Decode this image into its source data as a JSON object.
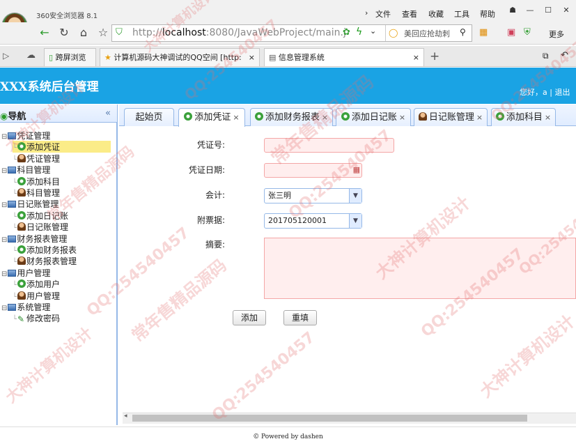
{
  "browser": {
    "name": "360安全浏览器 8.1",
    "menu": [
      "文件",
      "查看",
      "收藏",
      "工具",
      "帮助"
    ],
    "address_prefix": "http://",
    "address_host": "localhost",
    "address_path": ":8080/JavaWebProject/main.j",
    "search_text": "美回应抢劫刺",
    "more": "更多",
    "tabs": [
      {
        "label": "跨屏浏览"
      },
      {
        "label": "计算机源码大神调试的QQ空间 [http:"
      },
      {
        "label": "信息管理系统"
      }
    ]
  },
  "app": {
    "title": "XXX系统后台管理",
    "greeting": "您好，a",
    "logout": "退出"
  },
  "sidebar": {
    "title": "导航",
    "collapse": "«",
    "groups": [
      {
        "label": "凭证管理",
        "items": [
          {
            "label": "添加凭证",
            "icon": "add-icon"
          },
          {
            "label": "凭证管理",
            "icon": "user-icon"
          }
        ]
      },
      {
        "label": "科目管理",
        "items": [
          {
            "label": "添加科目",
            "icon": "add-icon"
          },
          {
            "label": "科目管理",
            "icon": "user-icon"
          }
        ]
      },
      {
        "label": "日记账管理",
        "items": [
          {
            "label": "添加日记账",
            "icon": "add-icon"
          },
          {
            "label": "日记账管理",
            "icon": "user-icon"
          }
        ]
      },
      {
        "label": "财务报表管理",
        "items": [
          {
            "label": "添加财务报表",
            "icon": "add-icon"
          },
          {
            "label": "财务报表管理",
            "icon": "user-icon"
          }
        ]
      },
      {
        "label": "用户管理",
        "items": [
          {
            "label": "添加用户",
            "icon": "add-icon"
          },
          {
            "label": "用户管理",
            "icon": "user-icon"
          }
        ]
      },
      {
        "label": "系统管理",
        "items": [
          {
            "label": "修改密码",
            "icon": "pencil-icon"
          }
        ]
      }
    ]
  },
  "page_tabs": [
    {
      "label": "起始页",
      "icon": ""
    },
    {
      "label": "添加凭证",
      "icon": "add-icon"
    },
    {
      "label": "添加财务报表",
      "icon": "add-icon"
    },
    {
      "label": "添加日记账",
      "icon": "add-icon"
    },
    {
      "label": "日记账管理",
      "icon": "user-icon"
    },
    {
      "label": "添加科目",
      "icon": "add-icon"
    }
  ],
  "tab_close": "×",
  "form": {
    "voucher_no_label": "凭证号:",
    "voucher_no_value": "",
    "voucher_date_label": "凭证日期:",
    "voucher_date_value": "",
    "accountant_label": "会计:",
    "accountant_value": "张三明",
    "attachment_label": "附票据:",
    "attachment_value": "201705120001",
    "summary_label": "摘要:",
    "summary_value": "",
    "add_button": "添加",
    "reset_button": "重填"
  },
  "footer": "© Powered by dashen",
  "watermark": {
    "texts": [
      "QQ:254540457",
      "常年售精品源码",
      "大神计算机设计"
    ],
    "color": "#e26e6e"
  },
  "colors": {
    "header": "#1aa3e4",
    "panel_border": "#95b8e7",
    "selected_item": "#fbec88",
    "required_field": "#ffeeee"
  }
}
